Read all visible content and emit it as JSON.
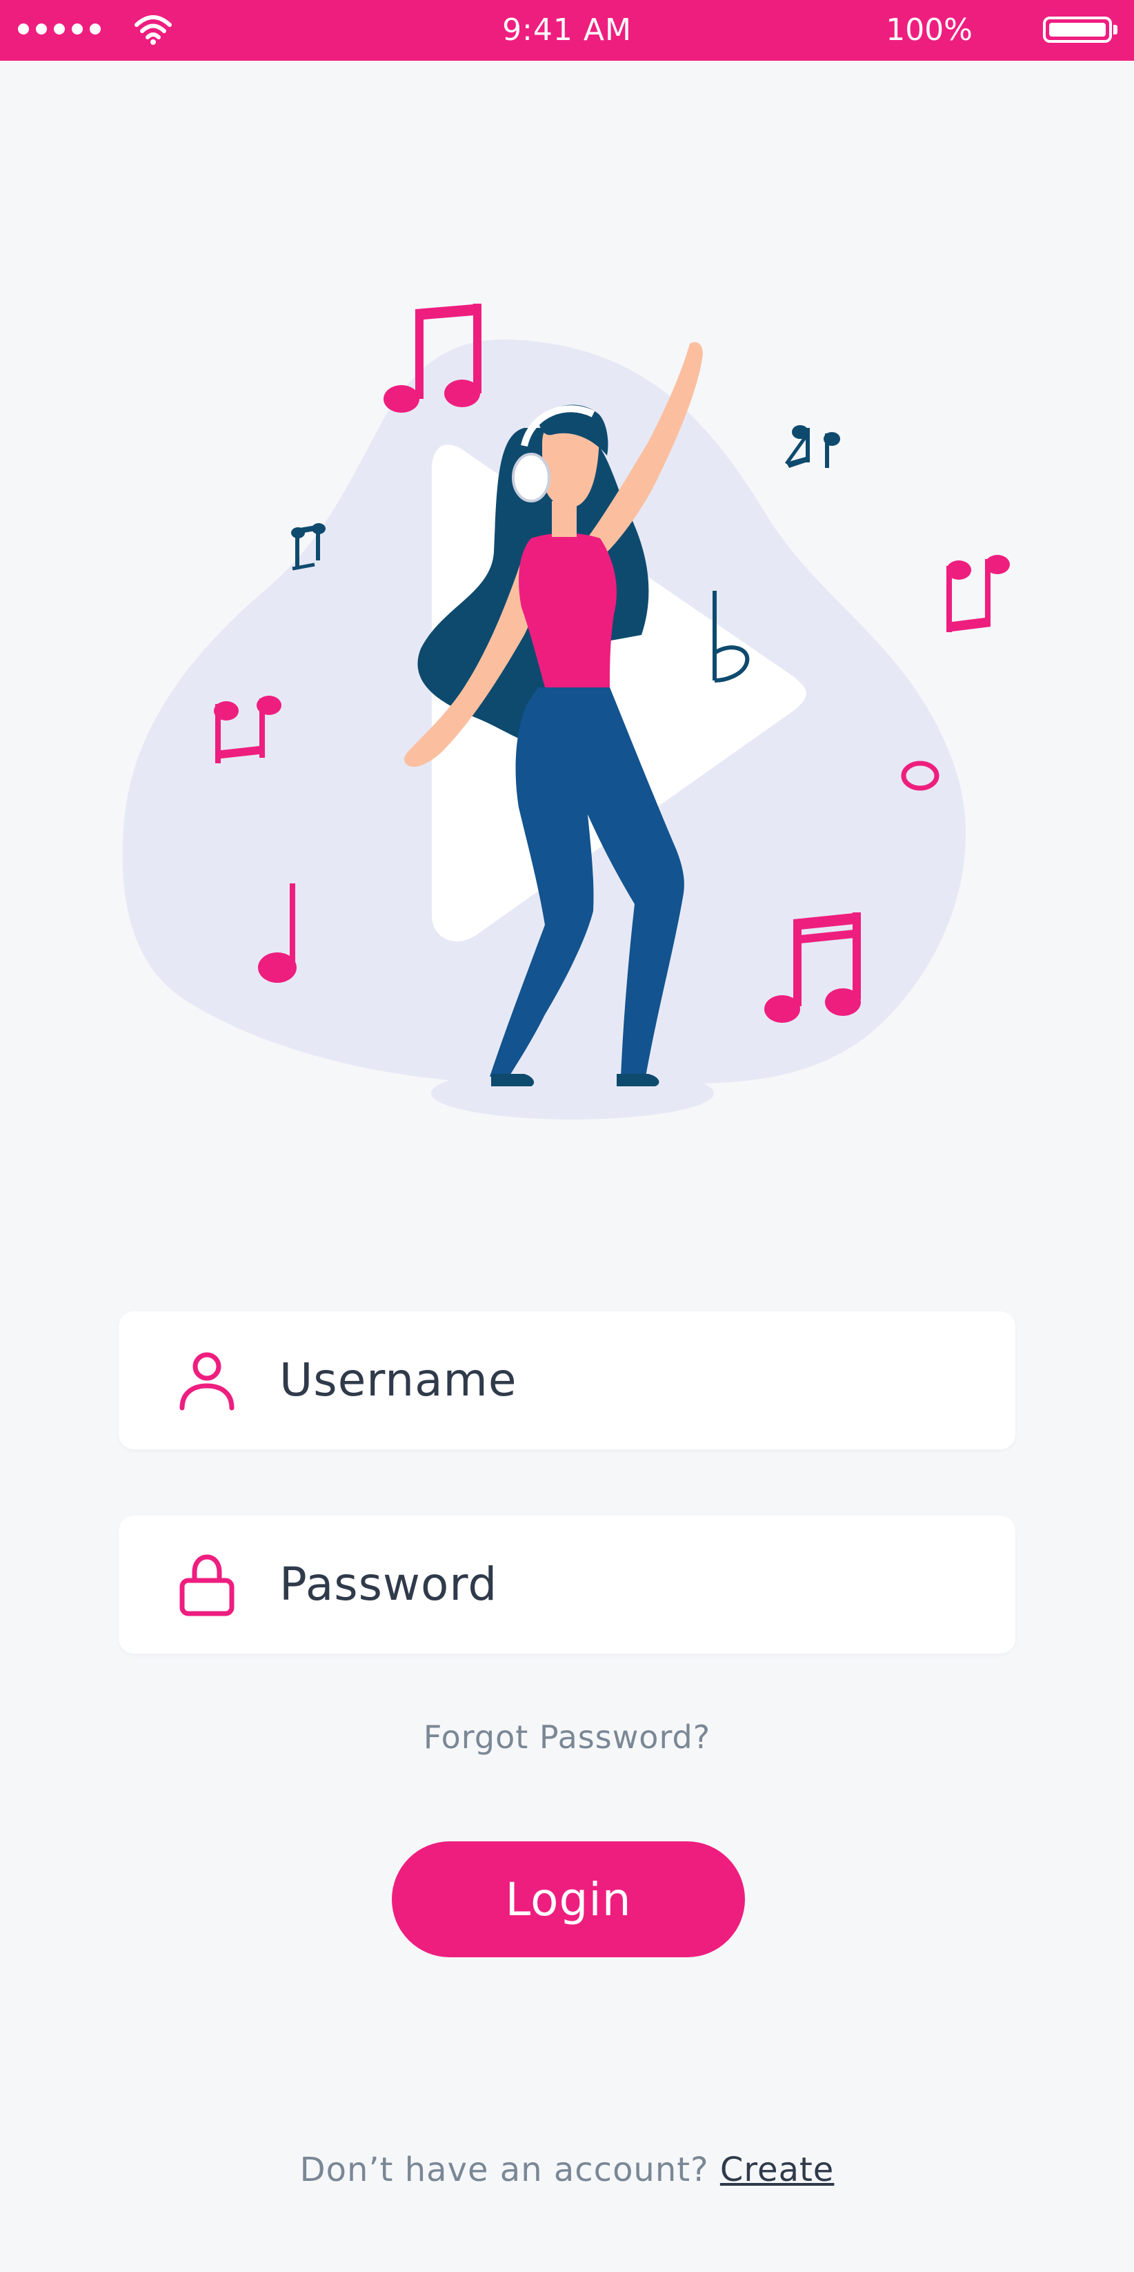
{
  "status_bar": {
    "time": "9:41 AM",
    "battery_percent": "100%",
    "signal_icon": "signal-dots-icon",
    "wifi_icon": "wifi-icon",
    "battery_icon": "battery-icon"
  },
  "illustration": {
    "description_icon": "dancing-woman-music-notes-illustration"
  },
  "form": {
    "username": {
      "placeholder": "Username",
      "icon": "user-icon"
    },
    "password": {
      "placeholder": "Password",
      "icon": "lock-icon"
    },
    "forgot_password": "Forgot Password?",
    "login_label": "Login"
  },
  "footer": {
    "prompt": "Don’t have an account?",
    "create_label": "Create"
  },
  "colors": {
    "accent": "#ee1e7f",
    "background": "#f6f7f9",
    "text_dark": "#2f3a4a",
    "text_muted": "#7a8795",
    "navy": "#0e4a6e",
    "denim": "#13538f",
    "blob": "#e6e9f5"
  }
}
